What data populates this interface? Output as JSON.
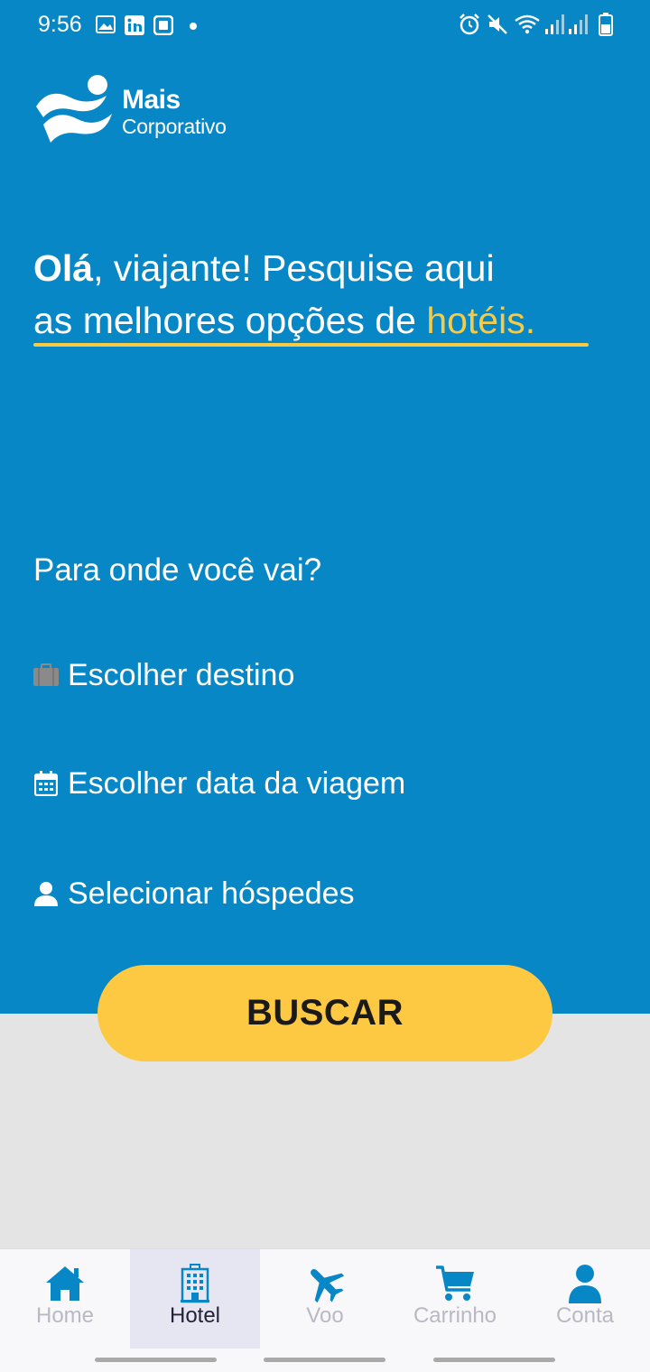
{
  "status_bar": {
    "time": "9:56",
    "icons": [
      "image-icon",
      "linkedin-icon",
      "download-icon",
      "dot-icon",
      "alarm-icon",
      "mute-icon",
      "wifi-icon",
      "signal-icon",
      "signal-icon",
      "battery-icon"
    ]
  },
  "brand": {
    "name_line1": "Mais",
    "name_line2": "Corporativo"
  },
  "headline": {
    "strong": "Olá",
    "text_1": ", viajante! Pesquise aqui",
    "text_2": "as melhores opções de ",
    "highlight": "hotéis."
  },
  "search": {
    "question": "Para onde você vai?",
    "destination_label": "Escolher destino",
    "date_label": "Escolher data da viagem",
    "guests_label": "Selecionar hóspedes",
    "button_label": "BUSCAR"
  },
  "nav": {
    "active": "Hotel",
    "items": [
      {
        "label": "Home",
        "icon": "home-icon"
      },
      {
        "label": "Hotel",
        "icon": "hotel-icon"
      },
      {
        "label": "Voo",
        "icon": "airplane-icon"
      },
      {
        "label": "Carrinho",
        "icon": "cart-icon"
      },
      {
        "label": "Conta",
        "icon": "user-icon"
      }
    ]
  },
  "colors": {
    "primary_blue": "#0787c6",
    "accent_yellow": "#f7cb46",
    "button_yellow": "#fdc942",
    "background_gray": "#e4e4e4"
  }
}
